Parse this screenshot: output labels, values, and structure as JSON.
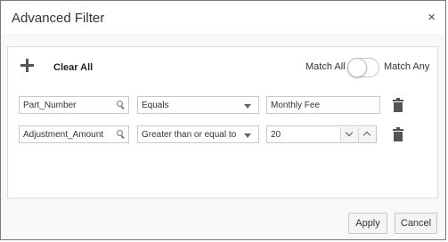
{
  "dialog": {
    "title": "Advanced Filter",
    "close_symbol": "×"
  },
  "toolbar": {
    "clear_all": "Clear All",
    "match_all": "Match All",
    "match_any": "Match Any",
    "match_mode": "all"
  },
  "rows": [
    {
      "field": "Part_Number",
      "operator": "Equals",
      "value": "Monthly Fee"
    },
    {
      "field": "Adjustment_Amount",
      "operator": "Greater than or equal to",
      "value": "20"
    }
  ],
  "icons": [
    "add-icon",
    "search-icon",
    "chevron-down-icon",
    "chevron-up-icon",
    "trash-icon",
    "close-icon"
  ],
  "footer": {
    "apply": "Apply",
    "cancel": "Cancel"
  }
}
